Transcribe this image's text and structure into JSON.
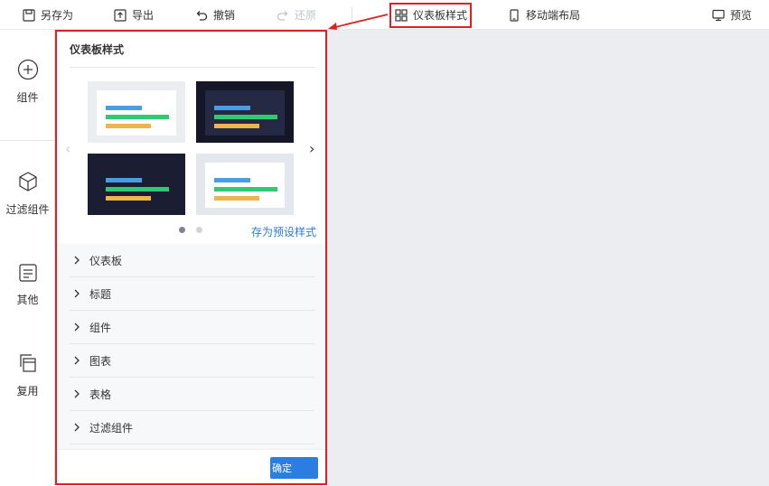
{
  "toolbar": {
    "save_as": "另存为",
    "export": "导出",
    "undo": "撤销",
    "redo": "还原",
    "dashboard_style": "仪表板样式",
    "mobile_layout": "移动端布局",
    "preview": "预览"
  },
  "sidebar": {
    "items": [
      {
        "label": "组件",
        "icon": "plus-circle-icon"
      },
      {
        "label": "过滤组件",
        "icon": "cube-icon"
      },
      {
        "label": "其他",
        "icon": "document-icon"
      },
      {
        "label": "复用",
        "icon": "copy-icon"
      }
    ]
  },
  "panel": {
    "title": "仪表板样式",
    "save_preset": "存为预设样式",
    "sections": [
      "仪表板",
      "标题",
      "组件",
      "图表",
      "表格",
      "过滤组件"
    ],
    "ok_button": "确定",
    "carousel_page": 1,
    "carousel_pages": 2
  },
  "colors": {
    "accent": "#2a7de1",
    "highlight": "#e02020",
    "bar_blue": "#4a9de3",
    "bar_green": "#2ecc71",
    "bar_orange": "#f0b44c",
    "dark_bg": "#1b1d33"
  }
}
